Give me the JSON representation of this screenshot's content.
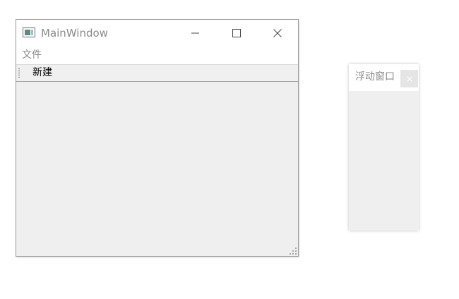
{
  "main_window": {
    "title": "MainWindow",
    "icon": "app-window-icon",
    "caption_buttons": {
      "minimize_icon": "minimize-icon",
      "maximize_icon": "maximize-icon",
      "close_icon": "close-icon"
    },
    "menu": {
      "items": [
        {
          "label": "文件"
        }
      ]
    },
    "toolbar": {
      "grip_icon": "toolbar-grip-icon",
      "actions": [
        {
          "label": "新建"
        }
      ]
    },
    "size_grip_icon": "size-grip-icon"
  },
  "dock_widget": {
    "title": "浮动窗口",
    "close_icon": "close-icon"
  },
  "colors": {
    "title_text": "#8a8a8a",
    "client_background": "#efefef",
    "title_bar_background": "#ffffff"
  }
}
